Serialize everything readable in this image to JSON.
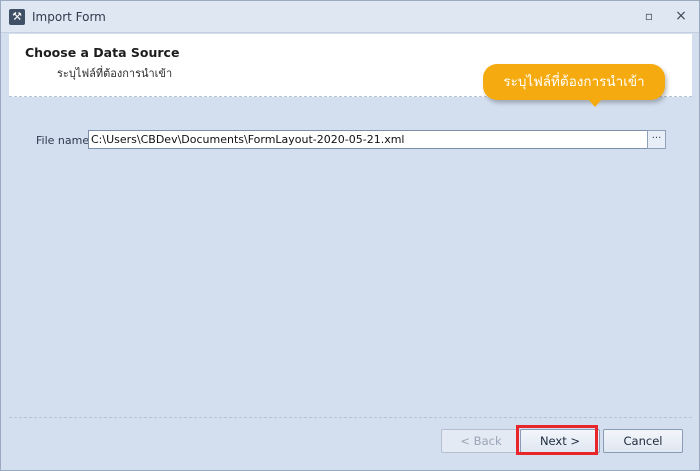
{
  "window": {
    "title": "Import Form",
    "icon": "wrench-icon",
    "restore_glyph": "▫",
    "close_glyph": "×"
  },
  "header": {
    "title": "Choose a Data Source",
    "subtitle": "ระบุไฟล์ที่ต้องการนำเข้า"
  },
  "callout": {
    "text": "ระบุไฟล์ที่ต้องการนำเข้า",
    "color": "#f5ab10"
  },
  "file": {
    "label": "File name",
    "value": "C:\\Users\\CBDev\\Documents\\FormLayout-2020-05-21.xml",
    "browse_label": "···"
  },
  "buttons": {
    "back": "< Back",
    "next": "Next >",
    "cancel": "Cancel"
  },
  "colors": {
    "body_bg": "#d3dfef",
    "highlight": "#e8262a"
  }
}
